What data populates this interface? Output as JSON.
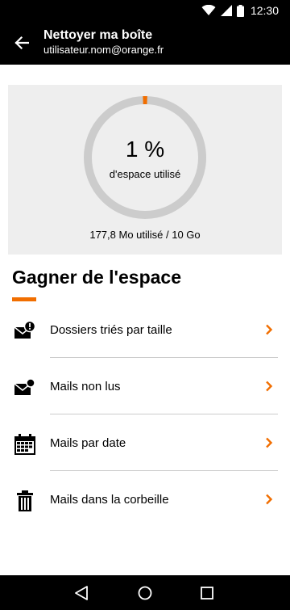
{
  "status_bar": {
    "time": "12:30",
    "icons": [
      "wifi-icon",
      "signal-icon",
      "battery-icon"
    ]
  },
  "app_bar": {
    "back_icon": "arrow-left-icon",
    "title": "Nettoyer ma boîte",
    "subtitle": "utilisateur.nom@orange.fr"
  },
  "usage": {
    "percent_text": "1 %",
    "percent_value": 0.01,
    "caption": "d'espace utilisé",
    "detail": "177,8 Mo utilisé / 10 Go"
  },
  "section": {
    "title": "Gagner de l'espace"
  },
  "menu": {
    "items": [
      {
        "label": "Dossiers triés par taille",
        "icon": "mail-alert-icon"
      },
      {
        "label": "Mails non lus",
        "icon": "mail-unread-icon"
      },
      {
        "label": "Mails par date",
        "icon": "calendar-icon"
      },
      {
        "label": "Mails dans la corbeille",
        "icon": "trash-icon"
      }
    ],
    "chevron_icon": "chevron-right-icon"
  },
  "nav_bar": {
    "icons": [
      "back-triangle-icon",
      "home-circle-icon",
      "recents-square-icon"
    ]
  },
  "colors": {
    "accent": "#f16e00",
    "bar_bg": "#000000",
    "card_bg": "#eeeeee",
    "gauge_track": "#cccccc"
  }
}
